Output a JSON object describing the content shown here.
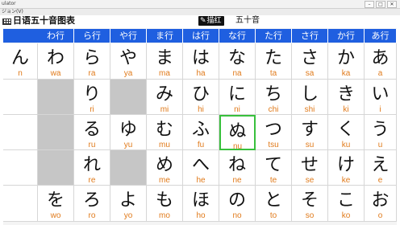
{
  "window": {
    "title": "ulator",
    "min_glyph": "–",
    "max_glyph": "□",
    "close_glyph": "✕"
  },
  "menu": {
    "label": "ジョン(V)"
  },
  "app": {
    "title": "日语五十音图表",
    "pen_label": "描红",
    "pen_icon": "✎",
    "mode_label": "五十音"
  },
  "columns": [
    "わ行",
    "ら行",
    "や行",
    "ま行",
    "は行",
    "な行",
    "た行",
    "さ行",
    "か行",
    "あ行"
  ],
  "rows": [
    [
      {
        "k": "ん",
        "r": "n"
      },
      {
        "k": "わ",
        "r": "wa"
      },
      {
        "k": "ら",
        "r": "ra"
      },
      {
        "k": "や",
        "r": "ya"
      },
      {
        "k": "ま",
        "r": "ma"
      },
      {
        "k": "は",
        "r": "ha"
      },
      {
        "k": "な",
        "r": "na"
      },
      {
        "k": "た",
        "r": "ta"
      },
      {
        "k": "さ",
        "r": "sa"
      },
      {
        "k": "か",
        "r": "ka"
      },
      {
        "k": "あ",
        "r": "a"
      }
    ],
    [
      null,
      null,
      {
        "k": "り",
        "r": "ri"
      },
      null,
      {
        "k": "み",
        "r": "mi"
      },
      {
        "k": "ひ",
        "r": "hi"
      },
      {
        "k": "に",
        "r": "ni"
      },
      {
        "k": "ち",
        "r": "chi"
      },
      {
        "k": "し",
        "r": "shi"
      },
      {
        "k": "き",
        "r": "ki"
      },
      {
        "k": "い",
        "r": "i"
      }
    ],
    [
      null,
      null,
      {
        "k": "る",
        "r": "ru"
      },
      {
        "k": "ゆ",
        "r": "yu"
      },
      {
        "k": "む",
        "r": "mu"
      },
      {
        "k": "ふ",
        "r": "fu"
      },
      {
        "k": "ぬ",
        "r": "nu"
      },
      {
        "k": "つ",
        "r": "tsu"
      },
      {
        "k": "す",
        "r": "su"
      },
      {
        "k": "く",
        "r": "ku"
      },
      {
        "k": "う",
        "r": "u"
      }
    ],
    [
      null,
      null,
      {
        "k": "れ",
        "r": "re"
      },
      null,
      {
        "k": "め",
        "r": "me"
      },
      {
        "k": "へ",
        "r": "he"
      },
      {
        "k": "ね",
        "r": "ne"
      },
      {
        "k": "て",
        "r": "te"
      },
      {
        "k": "せ",
        "r": "se"
      },
      {
        "k": "け",
        "r": "ke"
      },
      {
        "k": "え",
        "r": "e"
      }
    ],
    [
      null,
      {
        "k": "を",
        "r": "wo"
      },
      {
        "k": "ろ",
        "r": "ro"
      },
      {
        "k": "よ",
        "r": "yo"
      },
      {
        "k": "も",
        "r": "mo"
      },
      {
        "k": "ほ",
        "r": "ho"
      },
      {
        "k": "の",
        "r": "no"
      },
      {
        "k": "と",
        "r": "to"
      },
      {
        "k": "そ",
        "r": "so"
      },
      {
        "k": "こ",
        "r": "ko"
      },
      {
        "k": "お",
        "r": "o"
      }
    ]
  ],
  "selected": {
    "row": 2,
    "col": 6
  },
  "colors": {
    "header_blue": "#1f5fe0",
    "romaji_orange": "#e07a1a",
    "empty_gray": "#c6c6c6",
    "selection_green": "#38c03c"
  }
}
